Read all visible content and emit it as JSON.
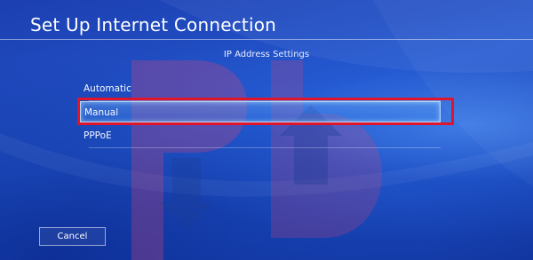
{
  "header": {
    "title": "Set Up Internet Connection"
  },
  "screen": {
    "subtitle": "IP Address Settings"
  },
  "options": [
    {
      "label": "Automatic",
      "selected": false
    },
    {
      "label": "Manual",
      "selected": true
    },
    {
      "label": "PPPoE",
      "selected": false
    }
  ],
  "footer": {
    "cancel_label": "Cancel"
  },
  "colors": {
    "background_blue": "#2357cf",
    "highlight_red": "#e0142b",
    "text": "#ffffff"
  },
  "watermark": {
    "letters": "pb"
  }
}
